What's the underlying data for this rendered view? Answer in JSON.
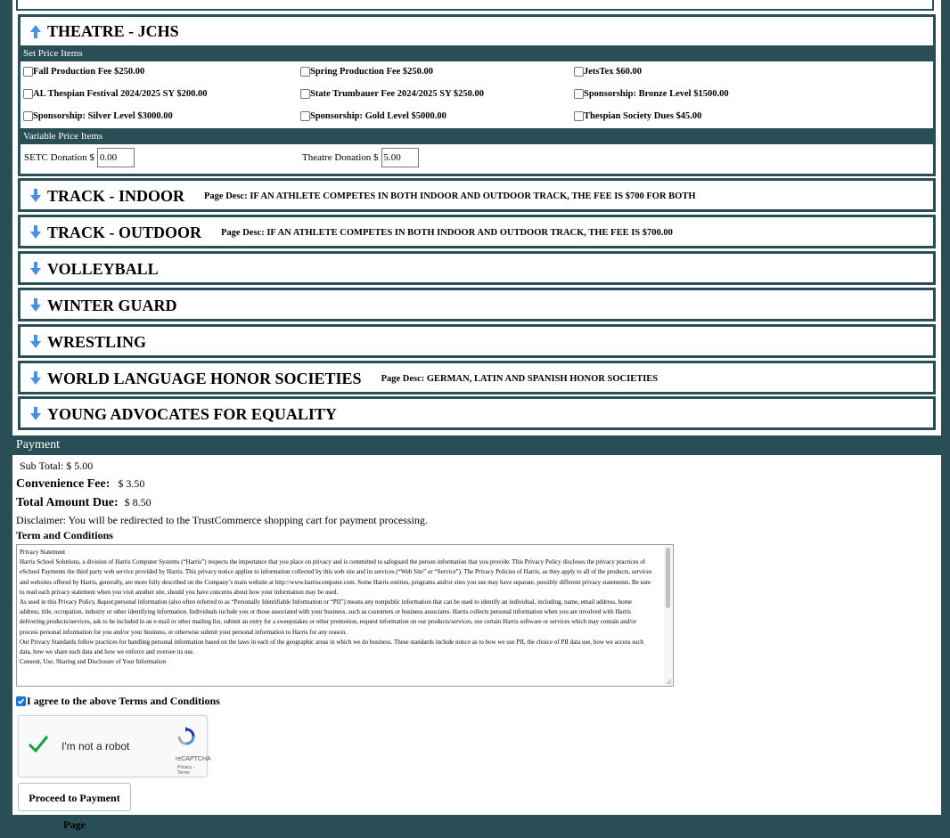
{
  "theatre": {
    "title": "THEATRE - JCHS",
    "set_price_label": "Set Price Items",
    "set_items": [
      "Fall Production Fee $250.00",
      "Spring Production Fee $250.00",
      "JetsTex $60.00",
      "AL Thespian Festival 2024/2025 SY $200.00",
      "State Trumbauer Fee 2024/2025 SY $250.00",
      "Sponsorship: Bronze Level $1500.00",
      "Sponsorship: Silver Level $3000.00",
      "Sponsorship: Gold Level $5000.00",
      "Thespian Society Dues $45.00"
    ],
    "variable_price_label": "Variable Price Items",
    "setc_label": "SETC Donation $",
    "setc_value": "0.00",
    "donation_label": "Theatre Donation $",
    "donation_value": "5.00"
  },
  "sections": [
    {
      "title": "TRACK - INDOOR",
      "desc": "Page Desc: IF AN ATHLETE COMPETES IN BOTH INDOOR AND OUTDOOR TRACK, THE FEE IS $700 FOR BOTH"
    },
    {
      "title": "TRACK - OUTDOOR",
      "desc": "Page Desc: IF AN ATHLETE COMPETES IN BOTH INDOOR AND OUTDOOR TRACK, THE FEE IS $700.00"
    },
    {
      "title": "VOLLEYBALL",
      "desc": ""
    },
    {
      "title": "WINTER GUARD",
      "desc": ""
    },
    {
      "title": "WRESTLING",
      "desc": ""
    },
    {
      "title": "WORLD LANGUAGE HONOR SOCIETIES",
      "desc": "Page Desc: GERMAN, LATIN AND SPANISH HONOR SOCIETIES"
    },
    {
      "title": "YOUNG ADVOCATES FOR EQUALITY",
      "desc": ""
    }
  ],
  "payment": {
    "header": "Payment",
    "subtotal_label": "Sub Total:",
    "subtotal_value": "$ 5.00",
    "fee_label": "Convenience Fee:",
    "fee_value": "$ 3.50",
    "total_label": "Total Amount Due:",
    "total_value": "$ 8.50",
    "disclaimer": "Disclaimer: You will be redirected to the TrustCommerce shopping cart for payment processing.",
    "terms_title": "Term and Conditions",
    "terms_lines": [
      "Privacy Statement",
      "Harris School Solutions, a division of Harris Computer Systems (“Harris”) respects the importance that you place on privacy and is committed  to safeguard the person information that you provide. This Privacy Policy discloses the privacy practices  of",
      "eSchool Payments the third party web service provided by Harris. This privacy notice applies to information  collected by this web site and its services (“Web Site” or “Service”). The Privacy Policies of Harris, as they  apply to all of the products, services",
      "and websites offered by Harris, generally, are more fully described on the  Company’s main website at http://www.harriscomputer.com. Some Harris entities, programs and/or sites you use may have  separate, possibly different privacy statements. Be sure",
      "to read each privacy statement when you visit another site,  should you have concerns about how your information may be used.",
      " As used in this Privacy Policy, &quot;personal  information (also often referred to as “Personally Identifiable Information or “PII”) means any nonpublic  information that can be used to identify an individual, including, name, email address, home",
      "address, title, occupation,  industry or other identifying information. Individuals include you or those associated with your business, such as customers  or business associates. Harris collects personal information when you are involved with Harris",
      "delivering products/services,  ask to be included in an e-mail or other mailing list, submit an entry for a sweepstakes or other promotion, request  information on our products/services, use certain Harris software or services which may contain and/or",
      "process personal  information for you and/or your business, or otherwise submit your personal information to Harris for any reason.",
      "Our Privacy Standards follow practices for handling personal information based on the laws in each of the geographic areas in which we do business. These standards include notice as to how we use PII, the choice of PII data use, how we access such",
      "data, how we share such data and how we enforce and oversee its use.",
      "Consent, Use, Sharing and Disclosure of Your Information"
    ],
    "agree_label": "I agree to the above Terms and Conditions",
    "captcha_label": "I'm not a robot",
    "captcha_brand": "reCAPTCHA",
    "captcha_links": "Privacy - Terms",
    "proceed_label": "Proceed to Payment Page"
  },
  "colors": {
    "accent": "#2a4e55",
    "arrow": "#4a90e2",
    "check": "#1976d2",
    "captcha_check": "#1a9e3f"
  }
}
